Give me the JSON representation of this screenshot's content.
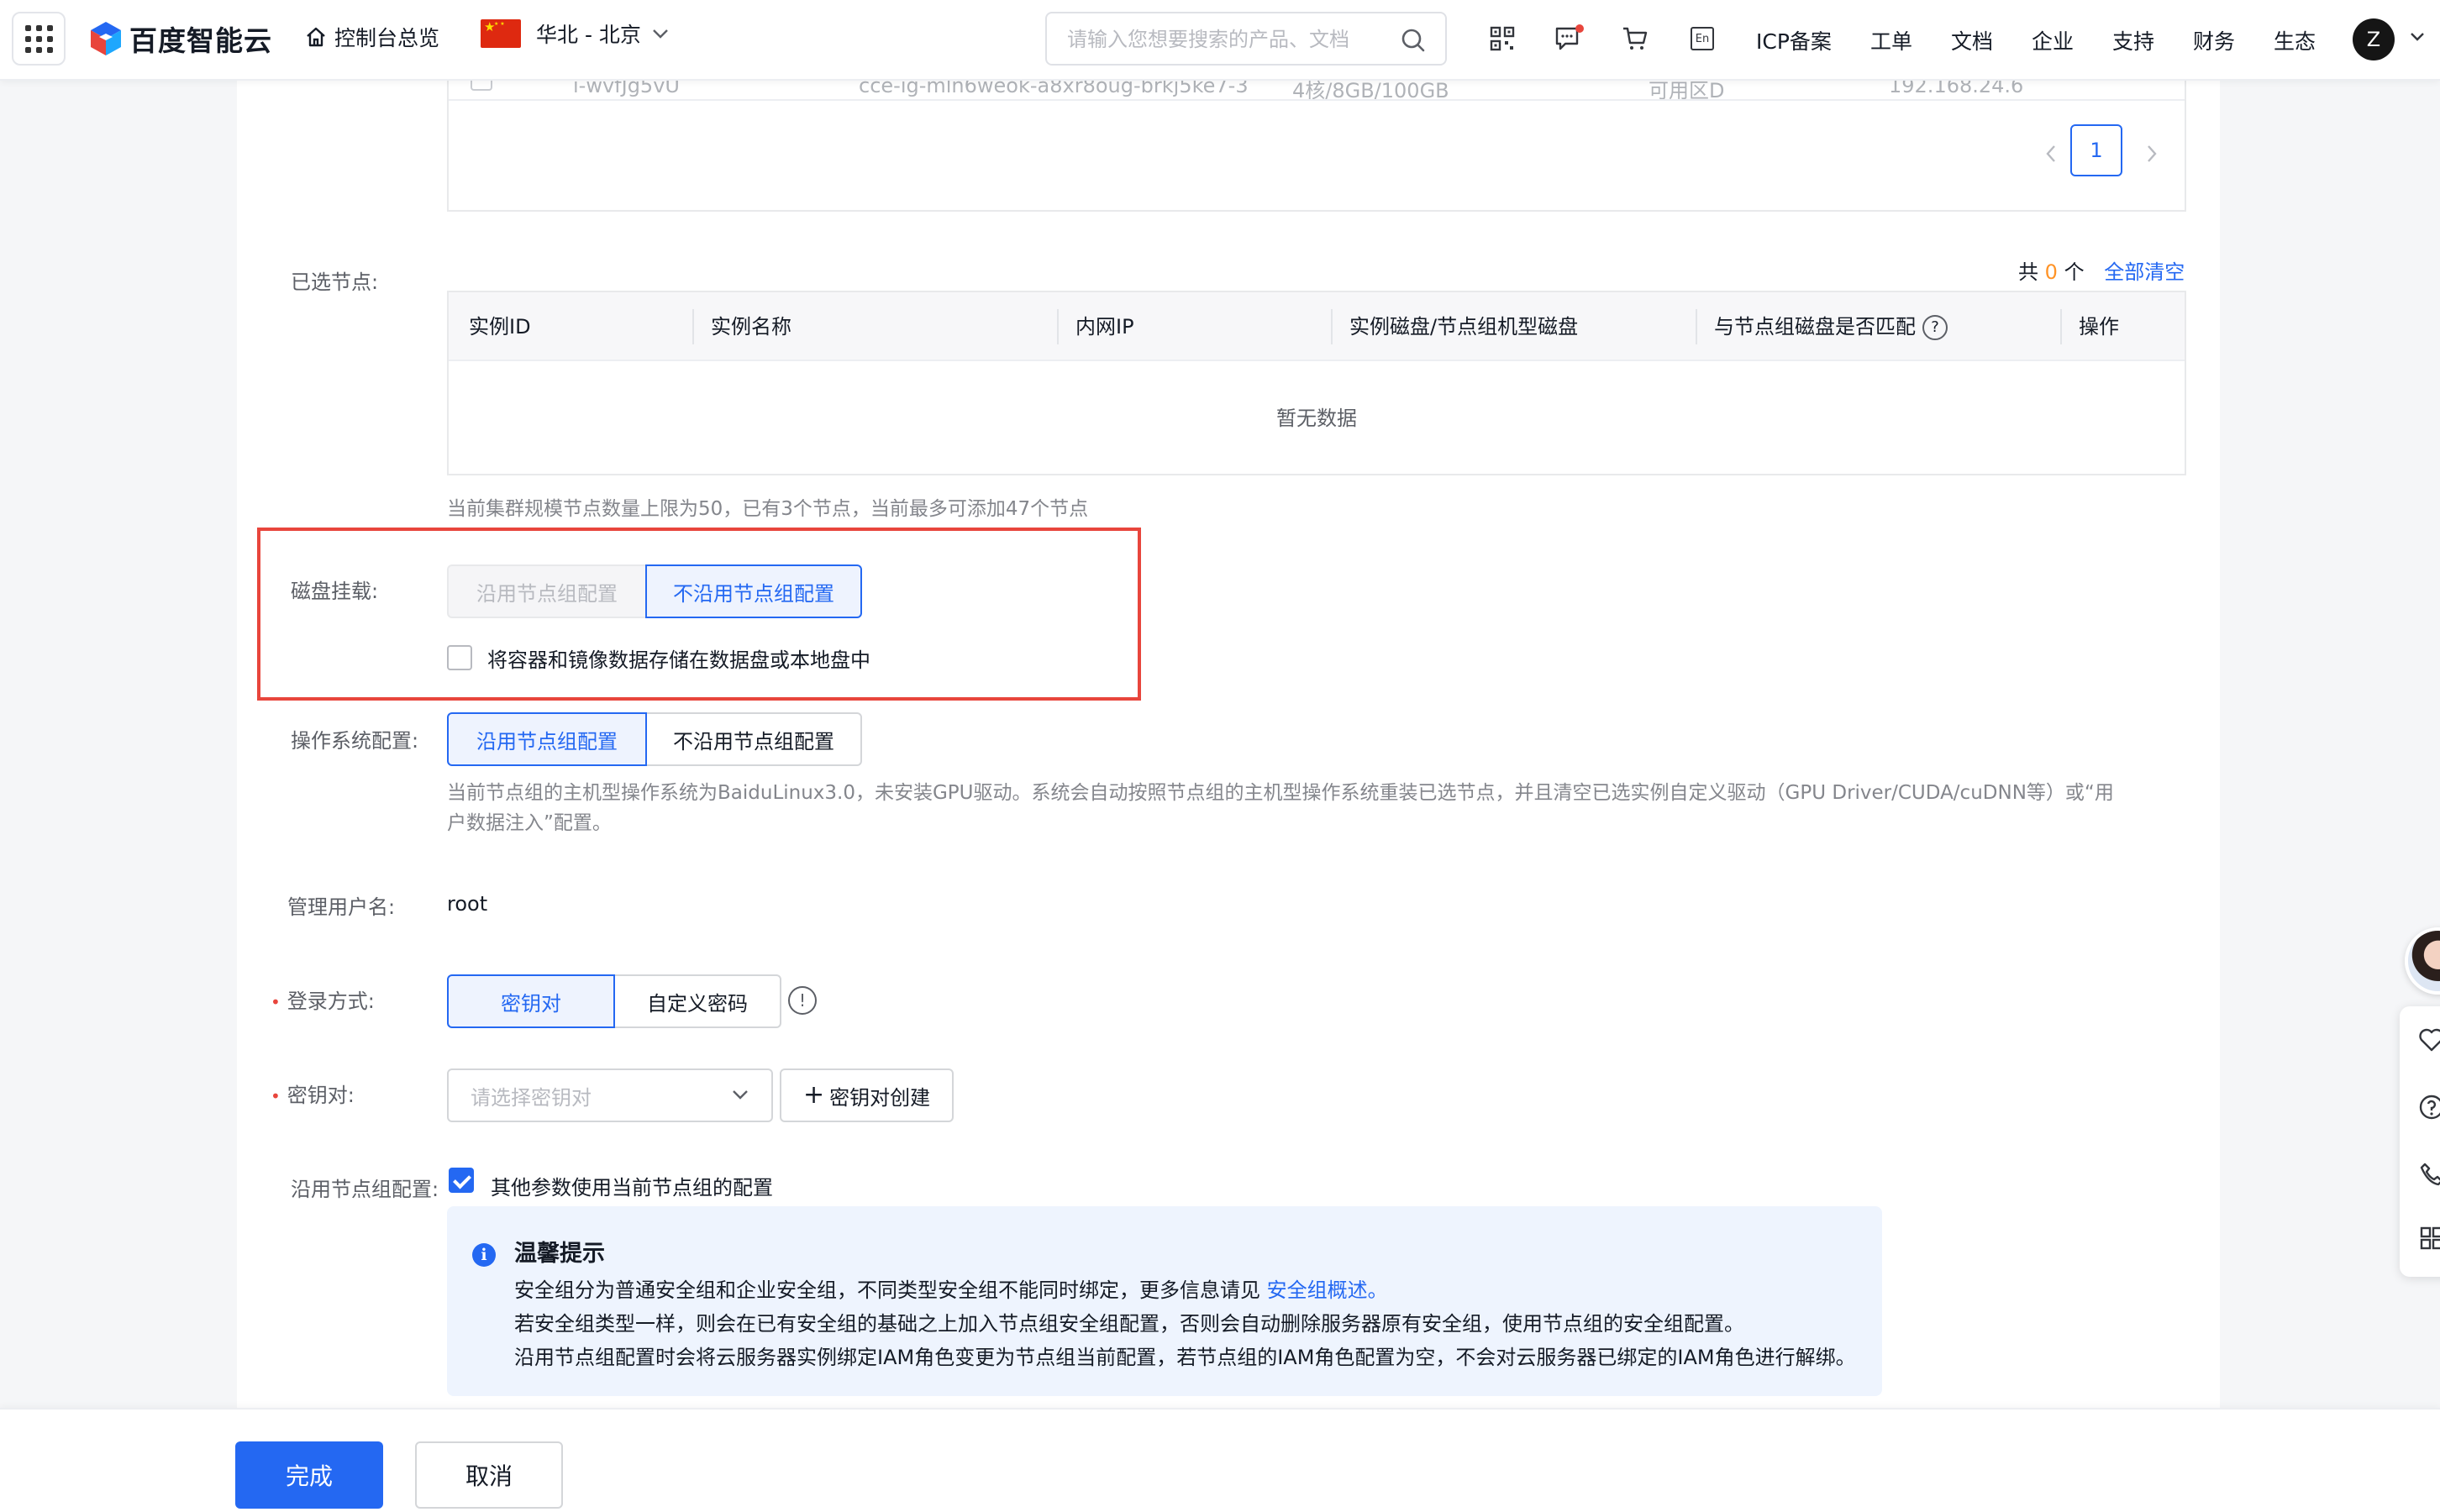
{
  "nav": {
    "logo_text": "百度智能云",
    "console_overview": "控制台总览",
    "region": "华北 - 北京",
    "search_placeholder": "请输入您想要搜索的产品、文档",
    "lang_badge": "En",
    "links": [
      "ICP备案",
      "工单",
      "文档",
      "企业",
      "支持",
      "财务",
      "生态"
    ],
    "avatar_initial": "Z"
  },
  "instance_table": {
    "partial_row": {
      "instance_id": "i-wvfJg5vU",
      "instance_name": "cce-ig-mln6weok-a8xr8oug-brkj5ke7-3",
      "spec": "4核/8GB/100GB",
      "zone": "可用区D",
      "ip": "192.168.24.6"
    },
    "pagination": {
      "current_page": "1"
    }
  },
  "selected_nodes": {
    "label": "已选节点:",
    "count_prefix": "共",
    "count": "0",
    "count_suffix": "个",
    "clear_all": "全部清空",
    "columns": [
      "实例ID",
      "实例名称",
      "内网IP",
      "实例磁盘/节点组机型磁盘",
      "与节点组磁盘是否匹配",
      "操作"
    ],
    "help_glyph": "?",
    "empty_text": "暂无数据",
    "limit_hint": "当前集群规模节点数量上限为50，已有3个节点，当前最多可添加47个节点"
  },
  "disk_mount": {
    "label": "磁盘挂载:",
    "options": [
      "沿用节点组配置",
      "不沿用节点组配置"
    ],
    "selected": "不沿用节点组配置",
    "checkbox_label": "将容器和镜像数据存储在数据盘或本地盘中",
    "checkbox_checked": false
  },
  "os_config": {
    "label": "操作系统配置:",
    "options": [
      "沿用节点组配置",
      "不沿用节点组配置"
    ],
    "selected": "沿用节点组配置",
    "hint_line1": "当前节点组的主机型操作系统为BaiduLinux3.0，未安装GPU驱动。系统会自动按照节点组的主机型操作系统重装已选节点，并且清空已选实例自定义驱动（GPU Driver/CUDA/cuDNN等）或“用",
    "hint_line2": "户数据注入”配置。"
  },
  "admin_user": {
    "label": "管理用户名:",
    "value": "root"
  },
  "login_method": {
    "required_mark": "•",
    "label": "登录方式:",
    "options": [
      "密钥对",
      "自定义密码"
    ],
    "selected": "密钥对",
    "info_glyph": "!"
  },
  "keypair": {
    "required_mark": "•",
    "label": "密钥对:",
    "placeholder": "请选择密钥对",
    "create_button": "密钥对创建",
    "plus_glyph": "+"
  },
  "inherit_config": {
    "label": "沿用节点组配置:",
    "checkbox_label": "其他参数使用当前节点组的配置",
    "checkbox_checked": true
  },
  "tip": {
    "icon_glyph": "i",
    "title": "温馨提示",
    "line1_text": "安全组分为普通安全组和企业安全组，不同类型安全组不能同时绑定，更多信息请见",
    "line1_link": "安全组概述。",
    "line2": "若安全组类型一样，则会在已有安全组的基础之上加入节点组安全组配置，否则会自动删除服务器原有安全组，使用节点组的安全组配置。",
    "line3": "沿用节点组配置时会将云服务器实例绑定IAM角色变更为节点组当前配置，若节点组的IAM角色配置为空，不会对云服务器已绑定的IAM角色进行解绑。"
  },
  "footer": {
    "confirm": "完成",
    "cancel": "取消"
  },
  "colors": {
    "primary": "#2468f2",
    "highlight_border": "#e8453c",
    "count_orange": "#ff9326"
  }
}
